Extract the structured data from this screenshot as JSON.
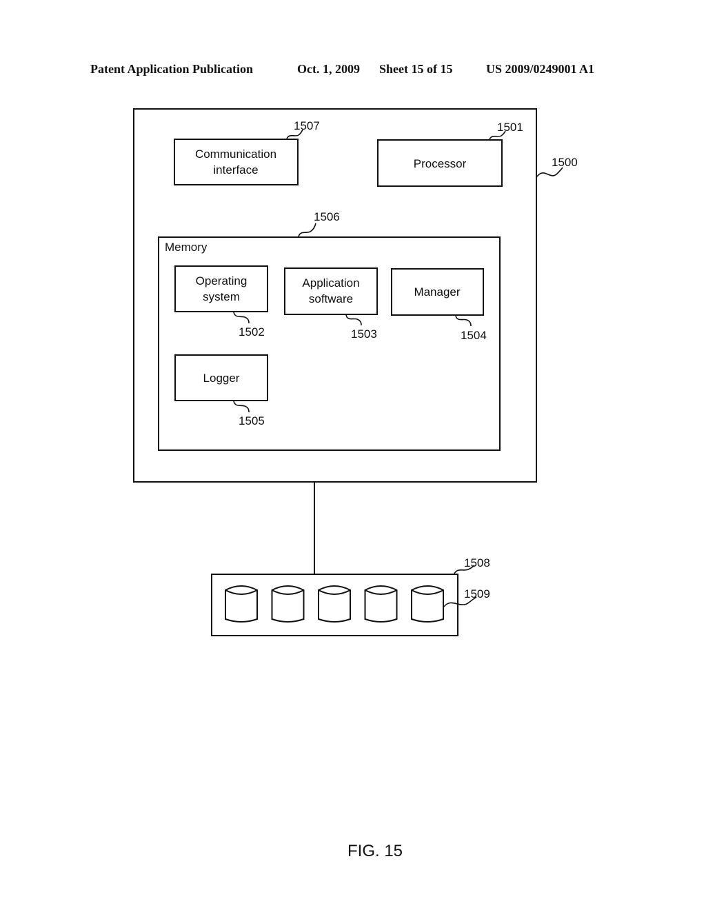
{
  "header": {
    "publication": "Patent Application Publication",
    "date": "Oct. 1, 2009",
    "sheet": "Sheet 15 of 15",
    "number": "US 2009/0249001 A1"
  },
  "diagram": {
    "system": {
      "ref": "1500"
    },
    "communication_interface": {
      "line1": "Communication",
      "line2": "interface",
      "ref": "1507"
    },
    "processor": {
      "label": "Processor",
      "ref": "1501"
    },
    "memory": {
      "label": "Memory",
      "ref": "1506",
      "operating_system": {
        "line1": "Operating",
        "line2": "system",
        "ref": "1502"
      },
      "application_software": {
        "line1": "Application",
        "line2": "software",
        "ref": "1503"
      },
      "manager": {
        "label": "Manager",
        "ref": "1504"
      },
      "logger": {
        "label": "Logger",
        "ref": "1505"
      }
    },
    "storage_array": {
      "ref": "1508",
      "disk_count": 5
    },
    "storage_disk": {
      "ref": "1509"
    }
  },
  "figure_label": "FIG. 15"
}
